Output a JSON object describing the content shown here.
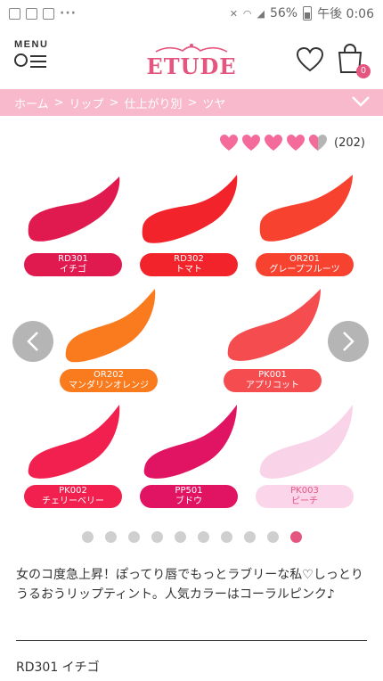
{
  "status_bar": {
    "battery": "56%",
    "time": "午後 0:06",
    "dots": "···"
  },
  "header": {
    "menu_label": "MENU",
    "logo": "ETUDE",
    "cart_count": "0"
  },
  "breadcrumb": [
    "ホーム",
    "リップ",
    "仕上がり別",
    "ツヤ"
  ],
  "breadcrumb_sep": ">",
  "rating": {
    "filled": 4,
    "total": 5,
    "count": "(202)"
  },
  "swatches": [
    {
      "code": "RD301",
      "name": "イチゴ",
      "color": "#e0194f",
      "label_color": "#e0194f"
    },
    {
      "code": "RD302",
      "name": "トマト",
      "color": "#f2232b",
      "label_color": "#f2232b"
    },
    {
      "code": "OR201",
      "name": "グレープフルーツ",
      "color": "#f6422f",
      "label_color": "#f6422f"
    },
    {
      "code": "OR202",
      "name": "マンダリンオレンジ",
      "color": "#f97b1e",
      "label_color": "#f97b1e"
    },
    {
      "code": "PK001",
      "name": "アプリコット",
      "color": "#f54d4f",
      "label_color": "#f54d4f"
    },
    {
      "code": "PK002",
      "name": "チェリーベリー",
      "color": "#f2204f",
      "label_color": "#f2204f"
    },
    {
      "code": "PP501",
      "name": "ブドウ",
      "color": "#e01463",
      "label_color": "#e01463"
    },
    {
      "code": "PK003",
      "name": "ピーチ",
      "color": "#f9d3e8",
      "label_color": "#fbd6eb"
    }
  ],
  "carousel": {
    "dot_count": 10,
    "active_index": 9
  },
  "colors": {
    "accent": "#e4557f",
    "crumb_bg": "#f7b9cb"
  },
  "description": "女のコ度急上昇！ぽってり唇でもっとラブリーな私♡しっとりうるおうリップティント。人気カラーはコーラルピンク♪",
  "current_selection": "RD301 イチゴ"
}
